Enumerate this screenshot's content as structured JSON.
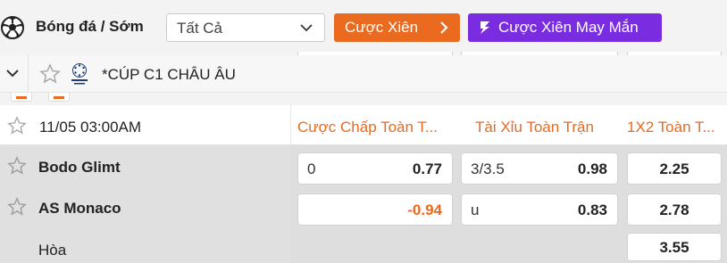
{
  "toolbar": {
    "sport_title": "Bóng đá / Sớm",
    "filter_value": "Tất Cả",
    "parlay_label": "Cược Xiên",
    "lucky_parlay_label": "Cược Xiên May Mắn",
    "accent_color": "#ea6a1f",
    "lucky_color": "#7a2ce0"
  },
  "league": {
    "name": "*CÚP C1 CHÂU ÂU",
    "icon": "champions-league-icon"
  },
  "match": {
    "time": "11/05 03:00AM",
    "columns": {
      "handicap": "Cược Chấp Toàn T...",
      "over_under": "Tài Xỉu Toàn Trận",
      "one_x_two": "1X2 Toàn T..."
    },
    "rows": [
      {
        "team": "Bodo Glimt",
        "handicap_line": "0",
        "handicap_odds": "0.77",
        "ou_line": "3/3.5",
        "ou_odds": "0.98",
        "x12": "2.25"
      },
      {
        "team": "AS Monaco",
        "handicap_line": "",
        "handicap_odds": "-0.94",
        "ou_line": "u",
        "ou_odds": "0.83",
        "x12": "2.78"
      },
      {
        "team": "Hòa",
        "x12": "3.55"
      }
    ]
  }
}
